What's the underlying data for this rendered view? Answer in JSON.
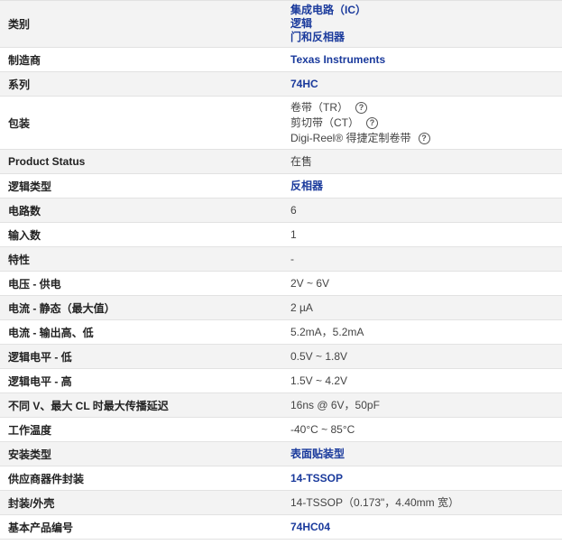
{
  "rows": [
    {
      "label": "类别",
      "type": "links",
      "values": [
        "集成电路（IC）",
        "逻辑",
        "门和反相器"
      ]
    },
    {
      "label": "制造商",
      "type": "links",
      "values": [
        "Texas Instruments"
      ]
    },
    {
      "label": "系列",
      "type": "links",
      "values": [
        "74HC"
      ]
    },
    {
      "label": "包装",
      "type": "help",
      "values": [
        "卷带（TR）",
        "剪切带（CT）",
        "Digi-Reel® 得捷定制卷带"
      ]
    },
    {
      "label": "Product Status",
      "type": "text",
      "values": [
        "在售"
      ]
    },
    {
      "label": "逻辑类型",
      "type": "links",
      "values": [
        "反相器"
      ]
    },
    {
      "label": "电路数",
      "type": "text",
      "values": [
        "6"
      ]
    },
    {
      "label": "输入数",
      "type": "text",
      "values": [
        "1"
      ]
    },
    {
      "label": "特性",
      "type": "text",
      "values": [
        "-"
      ]
    },
    {
      "label": "电压 - 供电",
      "type": "text",
      "values": [
        "2V ~ 6V"
      ]
    },
    {
      "label": "电流 - 静态（最大值）",
      "type": "text",
      "values": [
        "2 µA"
      ]
    },
    {
      "label": "电流 - 输出高、低",
      "type": "text",
      "values": [
        "5.2mA，5.2mA"
      ]
    },
    {
      "label": "逻辑电平 - 低",
      "type": "text",
      "values": [
        "0.5V ~ 1.8V"
      ]
    },
    {
      "label": "逻辑电平 - 高",
      "type": "text",
      "values": [
        "1.5V ~ 4.2V"
      ]
    },
    {
      "label": "不同 V、最大 CL 时最大传播延迟",
      "type": "text",
      "values": [
        "16ns @ 6V，50pF"
      ]
    },
    {
      "label": "工作温度",
      "type": "text",
      "values": [
        "-40°C ~ 85°C"
      ]
    },
    {
      "label": "安装类型",
      "type": "links",
      "values": [
        "表面贴装型"
      ]
    },
    {
      "label": "供应商器件封装",
      "type": "links",
      "values": [
        "14-TSSOP"
      ]
    },
    {
      "label": "封装/外壳",
      "type": "text",
      "values": [
        "14-TSSOP（0.173\"，4.40mm 宽）"
      ]
    },
    {
      "label": "基本产品编号",
      "type": "links",
      "values": [
        "74HC04"
      ]
    }
  ],
  "help_glyph": "?",
  "colors": {
    "link": "#1a3a9c",
    "row_alt": "#f3f3f3",
    "border": "#e2e2e2"
  }
}
